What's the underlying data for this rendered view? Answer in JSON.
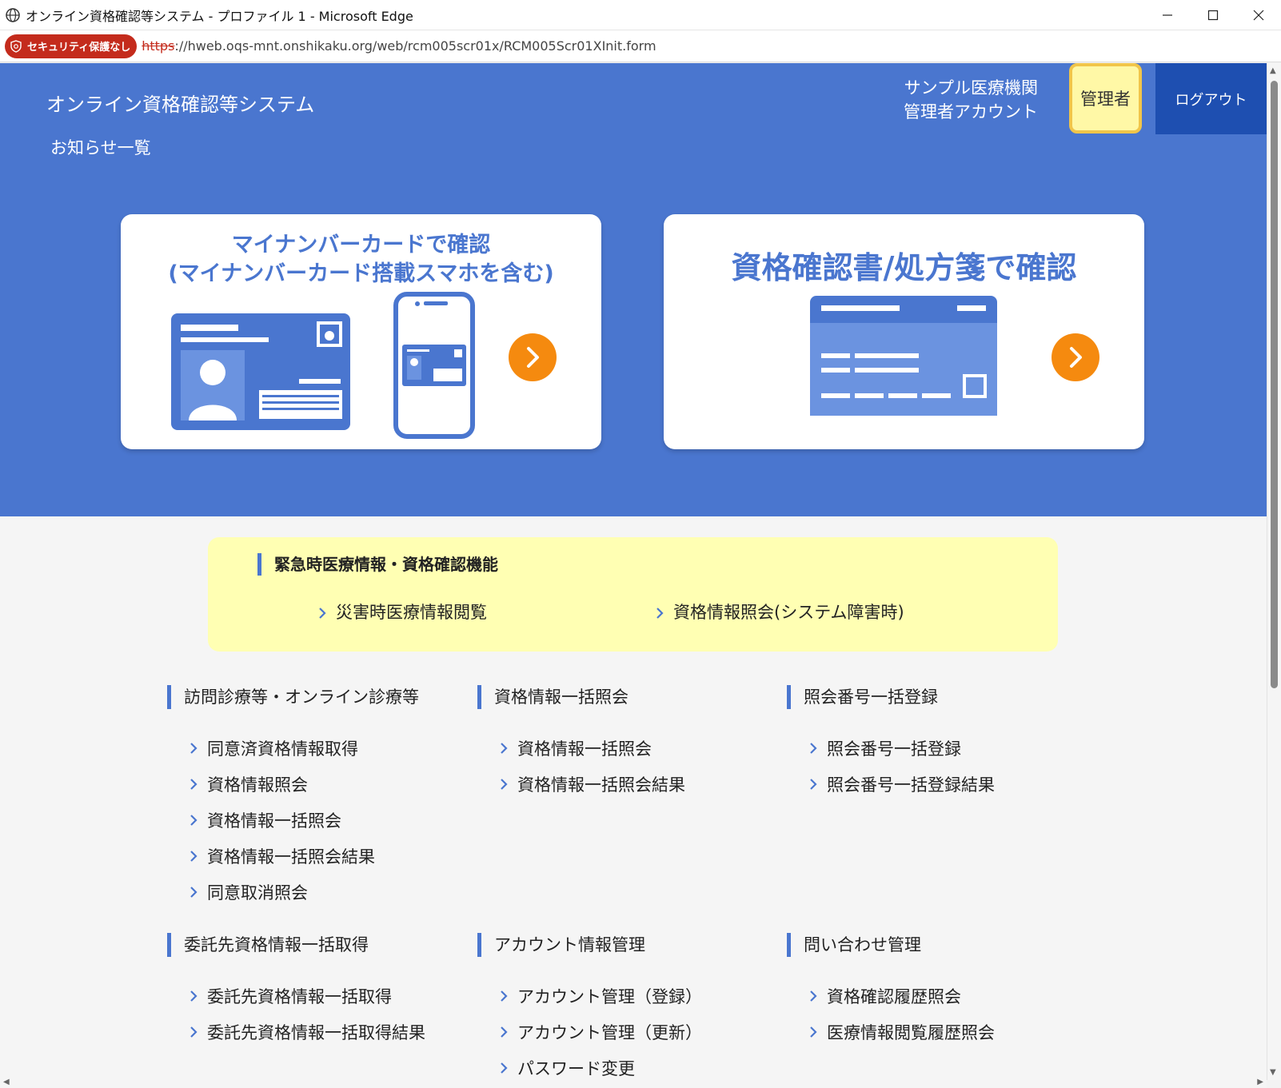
{
  "browser": {
    "window_title": "オンライン資格確認等システム - プロファイル 1 - Microsoft Edge",
    "security_badge": "セキュリティ保護なし",
    "url_protocol": "https",
    "url_rest": "://hweb.oqs-mnt.onshikaku.org/web/rcm005scr01x/RCM005Scr01XInit.form"
  },
  "header": {
    "system_title": "オンライン資格確認等システム",
    "notice_link": "お知らせ一覧",
    "org_name": "サンプル医療機関",
    "account_name": "管理者アカウント",
    "role_badge": "管理者",
    "logout_label": "ログアウト"
  },
  "cards": {
    "mynumber_line1": "マイナンバーカードで確認",
    "mynumber_line2": "(マイナンバーカード搭載スマホを含む)",
    "certificate_title": "資格確認書/処方箋で確認"
  },
  "emergency": {
    "title": "緊急時医療情報・資格確認機能",
    "links": [
      "災害時医療情報閲覧",
      "資格情報照会(システム障害時)"
    ]
  },
  "sections": [
    {
      "title": "訪問診療等・オンライン診療等",
      "items": [
        "同意済資格情報取得",
        "資格情報照会",
        "資格情報一括照会",
        "資格情報一括照会結果",
        "同意取消照会"
      ]
    },
    {
      "title": "資格情報一括照会",
      "items": [
        "資格情報一括照会",
        "資格情報一括照会結果"
      ]
    },
    {
      "title": "照会番号一括登録",
      "items": [
        "照会番号一括登録",
        "照会番号一括登録結果"
      ]
    },
    {
      "title": "委託先資格情報一括取得",
      "items": [
        "委託先資格情報一括取得",
        "委託先資格情報一括取得結果"
      ]
    },
    {
      "title": "アカウント情報管理",
      "items": [
        "アカウント管理（登録）",
        "アカウント管理（更新）",
        "パスワード変更"
      ]
    },
    {
      "title": "問い合わせ管理",
      "items": [
        "資格確認履歴照会",
        "医療情報閲覧履歴照会"
      ]
    }
  ],
  "colors": {
    "brand_blue": "#4a76cf",
    "logout_blue": "#1e4fb1",
    "accent_orange": "#f58a0f",
    "emergency_yellow": "#ffffb3",
    "role_yellow": "#fff8a6"
  }
}
